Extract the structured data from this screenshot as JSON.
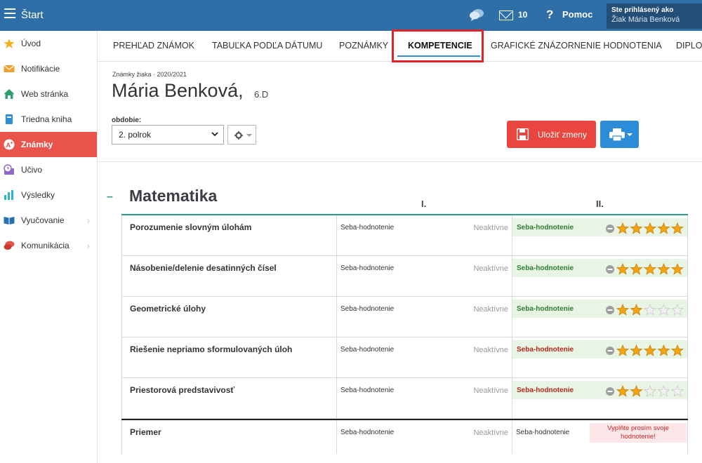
{
  "topbar": {
    "title": "Štart",
    "mail_count": "10",
    "help_label": "Pomoc",
    "user_line1": "Ste prihlásený ako",
    "user_line2": "Žiak Mária Benková"
  },
  "sidebar": {
    "items": [
      {
        "label": "Úvod",
        "icon": "star-icon"
      },
      {
        "label": "Notifikácie",
        "icon": "envelope-icon"
      },
      {
        "label": "Web stránka",
        "icon": "home-icon"
      },
      {
        "label": "Triedna kniha",
        "icon": "book-icon"
      },
      {
        "label": "Známky",
        "icon": "grade-icon"
      },
      {
        "label": "Učivo",
        "icon": "clock-icon"
      },
      {
        "label": "Výsledky",
        "icon": "bar-chart-icon"
      },
      {
        "label": "Vyučovanie",
        "icon": "open-book-icon"
      },
      {
        "label": "Komunikácia",
        "icon": "chat-icon"
      }
    ]
  },
  "tabs": [
    "PREHĽAD ZNÁMOK",
    "TABUĽKA PODĽA DÁTUMU",
    "POZNÁMKY",
    "KOMPETENCIE",
    "GRAFICKÉ ZNÁZORNENIE HODNOTENIA",
    "DIPLO"
  ],
  "header": {
    "breadcrumb": "Známky žiaka · 2020/2021",
    "student_name": "Mária Benková,",
    "student_class": "6.D",
    "period_label": "obdobie:",
    "period_value": "2. polrok",
    "save_label": "Uložiť zmeny"
  },
  "subject": {
    "title": "Matematika",
    "collapse_symbol": "–",
    "period1": "I.",
    "period2": "II."
  },
  "competencies": [
    {
      "name": "Porozumenie slovným úlohám",
      "self1": "Seba-hodnotenie",
      "status1": "Neaktívne",
      "self2": "Seba-hodnotenie",
      "self2_color": "green",
      "stars": 5
    },
    {
      "name": "Násobenie/delenie desatinných čísel",
      "self1": "Seba-hodnotenie",
      "status1": "Neaktívne",
      "self2": "Seba-hodnotenie",
      "self2_color": "green",
      "stars": 5
    },
    {
      "name": "Geometrické úlohy",
      "self1": "Seba-hodnotenie",
      "status1": "Neaktívne",
      "self2": "Seba-hodnotenie",
      "self2_color": "green",
      "stars": 2
    },
    {
      "name": "Riešenie nepriamo sformulovaných úloh",
      "self1": "Seba-hodnotenie",
      "status1": "Neaktívne",
      "self2": "Seba-hodnotenie",
      "self2_color": "red",
      "stars": 5
    },
    {
      "name": "Priestorová predstavivosť",
      "self1": "Seba-hodnotenie",
      "status1": "Neaktívne",
      "self2": "Seba-hodnotenie",
      "self2_color": "red",
      "stars": 2
    }
  ],
  "average": {
    "name": "Priemer",
    "self1": "Seba-hodnotenie",
    "status1": "Neaktívne",
    "self2": "Seba-hodnotenie",
    "warning": "Vyplňte prosím svoje hodnotenie!"
  },
  "colors": {
    "topbar": "#2f6fa7",
    "active_sidebar": "#e8534b",
    "save_button": "#e8463f",
    "print_button": "#2d8cd8",
    "accent_line": "#2a9d8f",
    "tab_highlight": "#e0242a"
  }
}
